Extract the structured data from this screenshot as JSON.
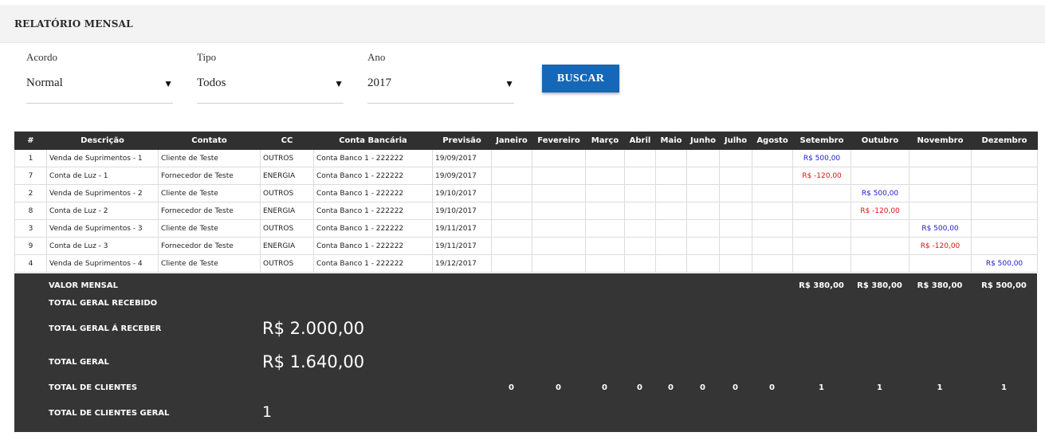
{
  "header": {
    "title": "RELATÓRIO MENSAL"
  },
  "filters": [
    {
      "label": "Acordo",
      "value": "Normal",
      "arrow": "▼"
    },
    {
      "label": "Tipo",
      "value": "Todos",
      "arrow": "▼"
    },
    {
      "label": "Ano",
      "value": "2017",
      "arrow": "▼"
    }
  ],
  "search_button": {
    "label": "BUSCAR"
  },
  "table": {
    "columns": [
      "#",
      "Descrição",
      "Contato",
      "CC",
      "Conta Bancária",
      "Previsão",
      "Janeiro",
      "Fevereiro",
      "Março",
      "Abril",
      "Maio",
      "Junho",
      "Julho",
      "Agosto",
      "Setembro",
      "Outubro",
      "Novembro",
      "Dezembro"
    ],
    "rows": [
      {
        "id": "1",
        "descricao": "Venda de Suprimentos - 1",
        "contato": "Cliente de Teste",
        "cc": "OUTROS",
        "conta": "Conta Banco 1 - 222222",
        "previsao": "19/09/2017",
        "month": 8,
        "amount": "R$ 500,00",
        "kind": "pos"
      },
      {
        "id": "7",
        "descricao": "Conta de Luz - 1",
        "contato": "Fornecedor de Teste",
        "cc": "ENERGIA",
        "conta": "Conta Banco 1 - 222222",
        "previsao": "19/09/2017",
        "month": 8,
        "amount": "R$ -120,00",
        "kind": "neg"
      },
      {
        "id": "2",
        "descricao": "Venda de Suprimentos - 2",
        "contato": "Cliente de Teste",
        "cc": "OUTROS",
        "conta": "Conta Banco 1 - 222222",
        "previsao": "19/10/2017",
        "month": 9,
        "amount": "R$ 500,00",
        "kind": "pos"
      },
      {
        "id": "8",
        "descricao": "Conta de Luz - 2",
        "contato": "Fornecedor de Teste",
        "cc": "ENERGIA",
        "conta": "Conta Banco 1 - 222222",
        "previsao": "19/10/2017",
        "month": 9,
        "amount": "R$ -120,00",
        "kind": "neg"
      },
      {
        "id": "3",
        "descricao": "Venda de Suprimentos - 3",
        "contato": "Cliente de Teste",
        "cc": "OUTROS",
        "conta": "Conta Banco 1 - 222222",
        "previsao": "19/11/2017",
        "month": 10,
        "amount": "R$ 500,00",
        "kind": "pos"
      },
      {
        "id": "9",
        "descricao": "Conta de Luz - 3",
        "contato": "Fornecedor de Teste",
        "cc": "ENERGIA",
        "conta": "Conta Banco 1 - 222222",
        "previsao": "19/11/2017",
        "month": 10,
        "amount": "R$ -120,00",
        "kind": "neg"
      },
      {
        "id": "4",
        "descricao": "Venda de Suprimentos - 4",
        "contato": "Cliente de Teste",
        "cc": "OUTROS",
        "conta": "Conta Banco 1 - 222222",
        "previsao": "19/12/2017",
        "month": 11,
        "amount": "R$ 500,00",
        "kind": "pos"
      }
    ]
  },
  "summary": {
    "valor_mensal_label": "VALOR MENSAL",
    "valor_mensal": [
      "",
      "",
      "",
      "",
      "",
      "",
      "",
      "",
      "R$ 380,00",
      "R$ 380,00",
      "R$ 380,00",
      "R$ 500,00"
    ],
    "total_recebido_label": "TOTAL GERAL RECEBIDO",
    "total_receber_label": "TOTAL GERAL Á RECEBER",
    "total_receber_value": "R$ 2.000,00",
    "total_geral_label": "TOTAL GERAL",
    "total_geral_value": "R$ 1.640,00",
    "total_clientes_label": "TOTAL DE CLIENTES",
    "total_clientes": [
      "0",
      "0",
      "0",
      "0",
      "0",
      "0",
      "0",
      "0",
      "1",
      "1",
      "1",
      "1"
    ],
    "total_clientes_geral_label": "TOTAL DE CLIENTES GERAL",
    "total_clientes_geral_value": "1"
  }
}
